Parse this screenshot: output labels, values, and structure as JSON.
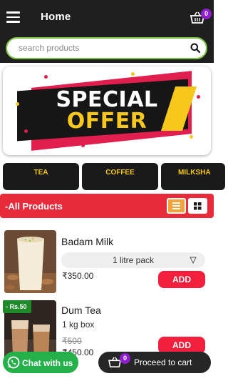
{
  "header": {
    "title": "Home",
    "cart_count": "0"
  },
  "search": {
    "placeholder": "search products"
  },
  "banner": {
    "line1": "SPECIAL",
    "line2": "OFFER"
  },
  "categories": [
    "TEA",
    "COFFEE",
    "MILKSHA"
  ],
  "products_bar": {
    "label": "-All Products"
  },
  "products": [
    {
      "name": "Badam Milk",
      "variant": "1 litre pack",
      "price": "₹350.00",
      "add_label": "ADD"
    },
    {
      "name": "Dum Tea",
      "unit": "1 kg box",
      "discount": "- Rs.50",
      "old_price": "₹500",
      "price": "₹450.00",
      "add_label": "ADD"
    }
  ],
  "footer": {
    "whatsapp_label": "Chat with us",
    "proceed_label": "Proceed to cart",
    "cart_count": "0"
  },
  "colors": {
    "header": "#1f1f1f",
    "accent_green": "#7bc242",
    "products_bar": "#e82b3a",
    "add_button": "#f2203d",
    "badge": "#8e1fd1",
    "category_text": "#f7c71b",
    "whatsapp": "#25b04a"
  }
}
